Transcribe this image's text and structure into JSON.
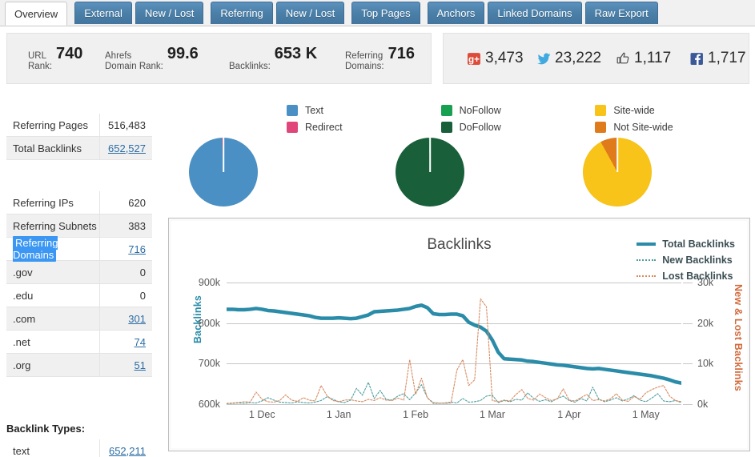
{
  "tabs": [
    {
      "label": "Overview",
      "active": true
    },
    {
      "label": "External",
      "active": false
    },
    {
      "label": "New / Lost",
      "active": false
    },
    {
      "label": "Referring",
      "active": false
    },
    {
      "label": "New / Lost",
      "active": false
    },
    {
      "label": "Top Pages",
      "active": false
    },
    {
      "label": "Anchors",
      "active": false
    },
    {
      "label": "Linked Domains",
      "active": false
    },
    {
      "label": "Raw Export",
      "active": false
    }
  ],
  "stats": [
    {
      "label_line1": "URL",
      "label_line2": "Rank:",
      "value": "740"
    },
    {
      "label_line1": "Ahrefs",
      "label_line2": "Domain Rank:",
      "value": "99.6"
    },
    {
      "label_line1": "",
      "label_line2": "Backlinks:",
      "value": "653 K"
    },
    {
      "label_line1": "Referring",
      "label_line2": "Domains:",
      "value": "716"
    }
  ],
  "social": [
    {
      "icon": "google-plus-icon",
      "value": "3,473",
      "color": "#dd4b39"
    },
    {
      "icon": "twitter-icon",
      "value": "23,222",
      "color": "#3fa9e0"
    },
    {
      "icon": "thumbs-up-icon",
      "value": "1,117",
      "color": "#4a4a4a"
    },
    {
      "icon": "facebook-icon",
      "value": "1,717",
      "color": "#3b5998"
    }
  ],
  "sidebar": {
    "group1": [
      {
        "key": "Referring Pages",
        "value": "516,483",
        "link": false,
        "alt": false
      },
      {
        "key": "Total Backlinks",
        "value": "652,527",
        "link": true,
        "alt": true
      }
    ],
    "group2": [
      {
        "key": "Referring IPs",
        "value": "620",
        "link": false,
        "alt": false
      },
      {
        "key": "Referring Subnets",
        "value": "383",
        "link": false,
        "alt": true
      },
      {
        "key": "Referring Domains",
        "value": "716",
        "link": true,
        "alt": false,
        "selected": true
      },
      {
        "key": ".gov",
        "value": "0",
        "link": false,
        "alt": true
      },
      {
        "key": ".edu",
        "value": "0",
        "link": false,
        "alt": false
      },
      {
        "key": ".com",
        "value": "301",
        "link": true,
        "alt": true
      },
      {
        "key": ".net",
        "value": "74",
        "link": true,
        "alt": false
      },
      {
        "key": ".org",
        "value": "51",
        "link": true,
        "alt": true
      }
    ],
    "group3_title": "Backlink Types:",
    "group3": [
      {
        "key": "text",
        "value": "652,211",
        "link": true,
        "alt": false
      }
    ]
  },
  "pie_legends": [
    [
      {
        "label": "Text",
        "color": "#4a90c4"
      },
      {
        "label": "Redirect",
        "color": "#e0467a"
      }
    ],
    [
      {
        "label": "NoFollow",
        "color": "#17a04f"
      },
      {
        "label": "DoFollow",
        "color": "#19603a"
      }
    ],
    [
      {
        "label": "Site-wide",
        "color": "#f8c419"
      },
      {
        "label": "Not Site-wide",
        "color": "#e07b1c"
      }
    ]
  ],
  "pies": [
    {
      "name": "link-type-pie",
      "slices": [
        {
          "label": "Text",
          "pct": 99.4,
          "color": "#4a90c4"
        },
        {
          "label": "Redirect",
          "pct": 0.6,
          "color": "#e0467a"
        }
      ]
    },
    {
      "name": "follow-pie",
      "slices": [
        {
          "label": "DoFollow",
          "pct": 99.5,
          "color": "#19603a"
        },
        {
          "label": "NoFollow",
          "pct": 0.5,
          "color": "#17a04f"
        }
      ]
    },
    {
      "name": "sitewide-pie",
      "slices": [
        {
          "label": "Site-wide",
          "pct": 92,
          "color": "#f8c419"
        },
        {
          "label": "Not Site-wide",
          "pct": 8,
          "color": "#e07b1c"
        }
      ]
    }
  ],
  "chart_data": {
    "type": "line",
    "title": "Backlinks",
    "xlabel": "",
    "ylabel": "Backlinks",
    "y2label": "New & Lost Backlinks",
    "ylim": [
      600000,
      900000
    ],
    "y2lim": [
      0,
      30000
    ],
    "yticks": [
      "600k",
      "700k",
      "800k",
      "900k"
    ],
    "y2ticks": [
      "0k",
      "10k",
      "20k",
      "30k"
    ],
    "xticks": [
      "1 Dec",
      "1 Jan",
      "1 Feb",
      "1 Mar",
      "1 Apr",
      "1 May"
    ],
    "grid": true,
    "legend_position": "top-right",
    "legend": [
      {
        "name": "Total Backlinks",
        "color": "#2a8ca8",
        "style": "solid",
        "width": 4
      },
      {
        "name": "New Backlinks",
        "color": "#4f9ea0",
        "style": "dashed",
        "width": 1
      },
      {
        "name": "Lost Backlinks",
        "color": "#d98a5f",
        "style": "dashed",
        "width": 1
      }
    ],
    "series": [
      {
        "name": "Total Backlinks",
        "axis": "left",
        "color": "#2a8ca8",
        "values": [
          834,
          834,
          833,
          833,
          834,
          836,
          834,
          831,
          830,
          828,
          826,
          824,
          822,
          820,
          818,
          814,
          812,
          812,
          812,
          813,
          812,
          811,
          812,
          816,
          820,
          828,
          829,
          830,
          831,
          832,
          834,
          836,
          841,
          844,
          838,
          823,
          821,
          821,
          822,
          822,
          818,
          802,
          795,
          790,
          780,
          758,
          728,
          712,
          711,
          710,
          709,
          706,
          705,
          703,
          701,
          699,
          697,
          696,
          694,
          692,
          690,
          688,
          687,
          688,
          686,
          684,
          682,
          680,
          678,
          676,
          674,
          672,
          670,
          667,
          664,
          660,
          655,
          652
        ]
      },
      {
        "name": "New Backlinks",
        "axis": "right",
        "color": "#4f9ea0",
        "values": [
          0.1,
          0.2,
          0.3,
          0.2,
          0.4,
          0.3,
          0.8,
          1.6,
          1.0,
          0.5,
          0.4,
          0.3,
          0.6,
          0.4,
          0.3,
          0.5,
          0.9,
          1.8,
          1.2,
          0.6,
          0.4,
          1.0,
          3.9,
          2.2,
          5.4,
          1.4,
          3.4,
          1.2,
          1.0,
          2.0,
          2.6,
          1.1,
          2.8,
          4.8,
          1.6,
          0.2,
          0.2,
          0.3,
          0.5,
          0.3,
          1.4,
          0.5,
          0.6,
          0.9,
          2.0,
          2.2,
          0.4,
          0.9,
          0.6,
          1.2,
          1.0,
          2.8,
          1.4,
          0.7,
          1.1,
          0.6,
          1.4,
          2.0,
          0.9,
          0.5,
          1.4,
          0.8,
          4.2,
          1.3,
          0.6,
          1.0,
          1.6,
          0.8,
          1.3,
          2.1,
          1.0,
          0.6,
          1.5,
          2.6,
          0.8,
          0.6,
          0.9,
          0.4
        ]
      },
      {
        "name": "Lost Backlinks",
        "axis": "right",
        "color": "#d98a5f",
        "values": [
          0.2,
          0.3,
          0.4,
          0.6,
          0.5,
          3.0,
          1.2,
          0.6,
          0.5,
          0.9,
          2.3,
          1.0,
          0.7,
          1.6,
          1.0,
          0.8,
          4.6,
          2.1,
          0.9,
          0.6,
          1.0,
          1.1,
          0.8,
          0.6,
          1.2,
          0.9,
          1.6,
          1.0,
          0.9,
          1.5,
          1.0,
          11.0,
          2.4,
          6.4,
          1.5,
          0.4,
          0.3,
          0.2,
          0.3,
          8.4,
          11.0,
          4.6,
          6.0,
          26.0,
          24.0,
          0.9,
          0.6,
          1.0,
          0.8,
          2.4,
          3.6,
          1.4,
          1.0,
          2.5,
          1.6,
          0.9,
          1.3,
          3.8,
          1.0,
          0.8,
          1.6,
          2.4,
          0.9,
          1.1,
          0.8,
          1.3,
          2.6,
          1.0,
          0.7,
          1.9,
          1.2,
          2.8,
          3.6,
          4.2,
          4.6,
          2.0,
          0.9,
          0.6
        ]
      }
    ]
  }
}
